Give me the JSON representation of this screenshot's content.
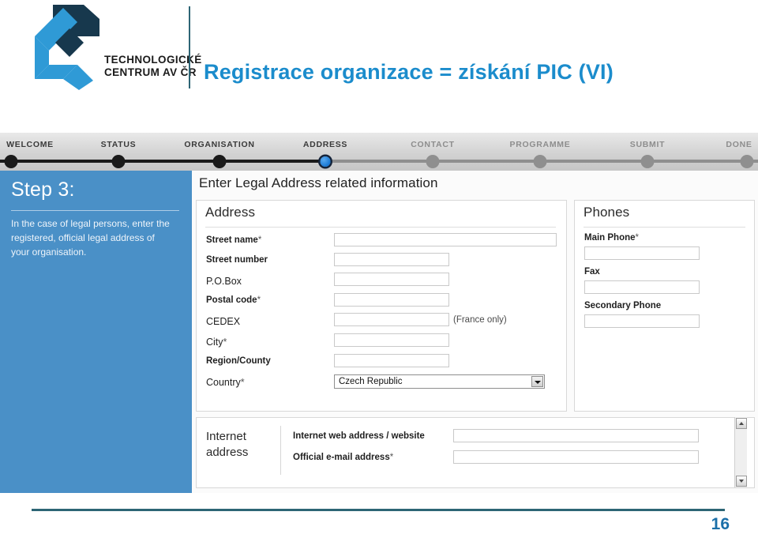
{
  "header": {
    "logo_text": "TECHNOLOGICKÉ\nCENTRUM AV ČR",
    "logo_icon": "tc-avcr-logo",
    "title": "Registrace organizace = získání PIC (VI)",
    "title_color": "#1b8ccc",
    "divider_color": "#2d6575"
  },
  "stepper": {
    "steps": [
      {
        "label": "WELCOME",
        "state": "done"
      },
      {
        "label": "STATUS",
        "state": "done"
      },
      {
        "label": "ORGANISATION",
        "state": "done"
      },
      {
        "label": "ADDRESS",
        "state": "active"
      },
      {
        "label": "CONTACT",
        "state": "todo"
      },
      {
        "label": "PROGRAMME",
        "state": "todo"
      },
      {
        "label": "SUBMIT",
        "state": "todo"
      },
      {
        "label": "DONE",
        "state": "todo"
      }
    ],
    "active_color": "#1878d4",
    "done_color": "#1a1a1a",
    "todo_color": "#8f8f8f"
  },
  "side_panel": {
    "background": "#4a90c7",
    "step_title": "Step 3:",
    "step_text": "In the case of legal persons, enter the registered, official legal address of your organisation."
  },
  "content": {
    "heading": "Enter Legal Address related information",
    "address_card": {
      "title": "Address",
      "fields": [
        {
          "label": "Street name",
          "required": true,
          "value": "",
          "placeholder": ""
        },
        {
          "label": "Street number",
          "required": false,
          "value": "",
          "placeholder": ""
        },
        {
          "label": "P.O.Box",
          "required": false,
          "value": "",
          "placeholder": ""
        },
        {
          "label": "Postal code",
          "required": true,
          "value": "",
          "placeholder": ""
        },
        {
          "label": "CEDEX",
          "required": false,
          "value": "",
          "placeholder": "",
          "hint": "(France only)"
        },
        {
          "label": "City",
          "required": true,
          "value": "",
          "placeholder": ""
        },
        {
          "label": "Region/County",
          "required": false,
          "value": "",
          "placeholder": ""
        }
      ],
      "country": {
        "label": "Country",
        "required": true,
        "selected": "Czech Republic",
        "icon": "chevron-down-icon"
      }
    },
    "phones_card": {
      "title": "Phones",
      "fields": [
        {
          "label": "Main Phone",
          "required": true,
          "value": "",
          "placeholder": ""
        },
        {
          "label": "Fax",
          "required": false,
          "value": "",
          "placeholder": ""
        },
        {
          "label": "Secondary Phone",
          "required": false,
          "value": "",
          "placeholder": ""
        }
      ]
    },
    "internet_card": {
      "title": "Internet\naddress",
      "fields": [
        {
          "label": "Internet web address / website",
          "required": false,
          "value": "",
          "placeholder": ""
        },
        {
          "label": "Official e-mail address",
          "required": true,
          "value": "",
          "placeholder": ""
        }
      ]
    },
    "required_marker": "*"
  },
  "scrollbar": {
    "up_icon": "triangle-up-icon",
    "down_icon": "triangle-down-icon"
  },
  "footer": {
    "page_number": "16",
    "rule_color": "#2d6575"
  }
}
